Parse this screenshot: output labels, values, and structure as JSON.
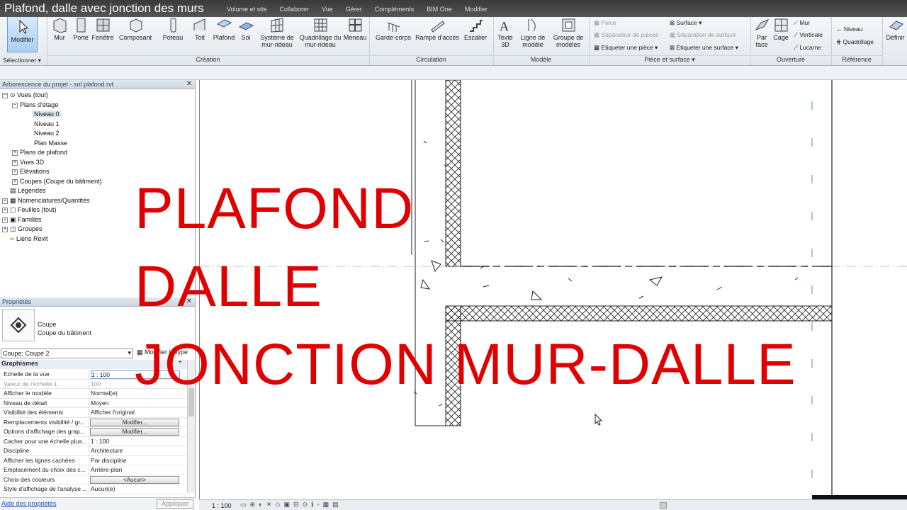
{
  "video_title": "Plafond, dalle avec jonction des murs",
  "menu_tabs": [
    "Volume et site",
    "Collaborer",
    "Vue",
    "Gérer",
    "Compléments",
    "BIM One",
    "Modifier"
  ],
  "ribbon": {
    "modify_label": "Modifier",
    "select_label": "Sélectionner",
    "creation_buttons": [
      "Mur",
      "Porte",
      "Fenêtre",
      "Composant",
      "Poteau",
      "Toit",
      "Plafond",
      "Sol",
      "Système de mur-rideau",
      "Quadrillage du mur-rideau",
      "Meneau"
    ],
    "creation_group": "Création",
    "circulation_buttons": [
      "Garde-corps",
      "Rampe d'accès",
      "Escalier"
    ],
    "circulation_group": "Circulation",
    "model_buttons": [
      "Texte 3D",
      "Ligne de modèle",
      "Groupe de modèles"
    ],
    "model_group": "Modèle",
    "room_small": [
      "Pièce",
      "Séparateur de pièces",
      "Etiqueter une pièce",
      "Surface",
      "Séparation de surface",
      "Etiqueter une surface"
    ],
    "room_group": "Pièce et surface",
    "opening_buttons": [
      "Par face",
      "Cage",
      "Mur",
      "Verticale",
      "Lucarne"
    ],
    "opening_group": "Ouverture",
    "reference_buttons": [
      "Niveau",
      "Quadrillage"
    ],
    "reference_group": "Référence",
    "define_label": "Définir"
  },
  "browser": {
    "title": "Arborescence du projet - sol plafond.rvt",
    "items": [
      "Vues (tout)",
      "Plans d'étage",
      "Niveau 0",
      "Niveau 1",
      "Niveau 2",
      "Plan Masse",
      "Plans de plafond",
      "Vues 3D",
      "Elévations",
      "Coupes (Coupe du bâtiment)",
      "Légendes",
      "Nomenclatures/Quantités",
      "Feuilles (tout)",
      "Familles",
      "Groupes",
      "Liens Revit"
    ]
  },
  "properties": {
    "title": "Propriétés",
    "type_name": "Coupe",
    "type_sub": "Coupe du bâtiment",
    "instance_select": "Coupe: Coupe 2",
    "edit_type": "Modifier le type",
    "section": "Graphismes",
    "rows": [
      {
        "k": "Echelle de la vue",
        "v": "1 : 100"
      },
      {
        "k": "Valeur de l'échelle    1:",
        "v": "100"
      },
      {
        "k": "Afficher le modèle",
        "v": "Normal(e)"
      },
      {
        "k": "Niveau de détail",
        "v": "Moyen"
      },
      {
        "k": "Visibilité des éléments",
        "v": "Afficher l'original"
      },
      {
        "k": "Remplacements visibilité / gr...",
        "v": "Modifier..."
      },
      {
        "k": "Options d'affichage des grap...",
        "v": "Modifier..."
      },
      {
        "k": "Cacher pour une échelle plus...",
        "v": "1 : 100"
      },
      {
        "k": "Discipline",
        "v": "Architecture"
      },
      {
        "k": "Afficher les lignes cachées",
        "v": "Par discipline"
      },
      {
        "k": "Emplacement du choix des c...",
        "v": "Arrière-plan"
      },
      {
        "k": "Choix des couleurs",
        "v": "<Aucun>"
      },
      {
        "k": "Style d'affichage de l'analyse ...",
        "v": "Aucun(e)"
      }
    ],
    "help_link": "Aide des propriétés",
    "apply": "Appliquer"
  },
  "overlay": [
    "PLAFOND",
    "DALLE",
    "JONCTION MUR-DALLE"
  ],
  "status": {
    "scale": "1 : 100"
  }
}
